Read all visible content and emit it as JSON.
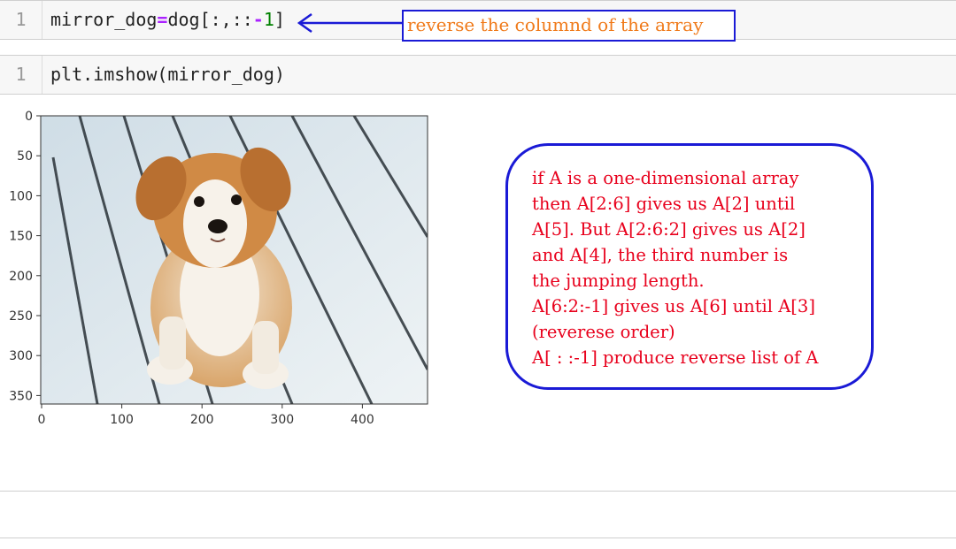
{
  "cells": [
    {
      "line_number": "1",
      "code_tokens": [
        {
          "text": "mirror_dog",
          "kind": "name"
        },
        {
          "text": "=",
          "kind": "op"
        },
        {
          "text": "dog[:,::",
          "kind": "name"
        },
        {
          "text": "-",
          "kind": "op"
        },
        {
          "text": "1",
          "kind": "num"
        },
        {
          "text": "]",
          "kind": "name"
        }
      ]
    },
    {
      "line_number": "1",
      "code": "plt.imshow(mirror_dog)"
    }
  ],
  "annotation_top": "reverse the columnd of the array",
  "annotation_box_lines": [
    "if A is a one-dimensional array",
    "then A[2:6] gives us A[2] until",
    "A[5]. But A[2:6:2] gives us A[2]",
    "and A[4], the third number is",
    "the jumping length.",
    "A[6:2:-1] gives us A[6] until A[3]",
    "(reverese order)",
    "A[ : :-1] produce reverse list of A"
  ],
  "plot": {
    "y_ticks": [
      "0",
      "50",
      "100",
      "150",
      "200",
      "250",
      "300",
      "350"
    ],
    "x_ticks": [
      "0",
      "100",
      "200",
      "300",
      "400"
    ],
    "image_subject": "puppy-photo"
  },
  "colors": {
    "annotation_border": "#1a1ad6",
    "annotation_top_text": "#f07a1a",
    "annotation_box_text": "#e8001c"
  }
}
